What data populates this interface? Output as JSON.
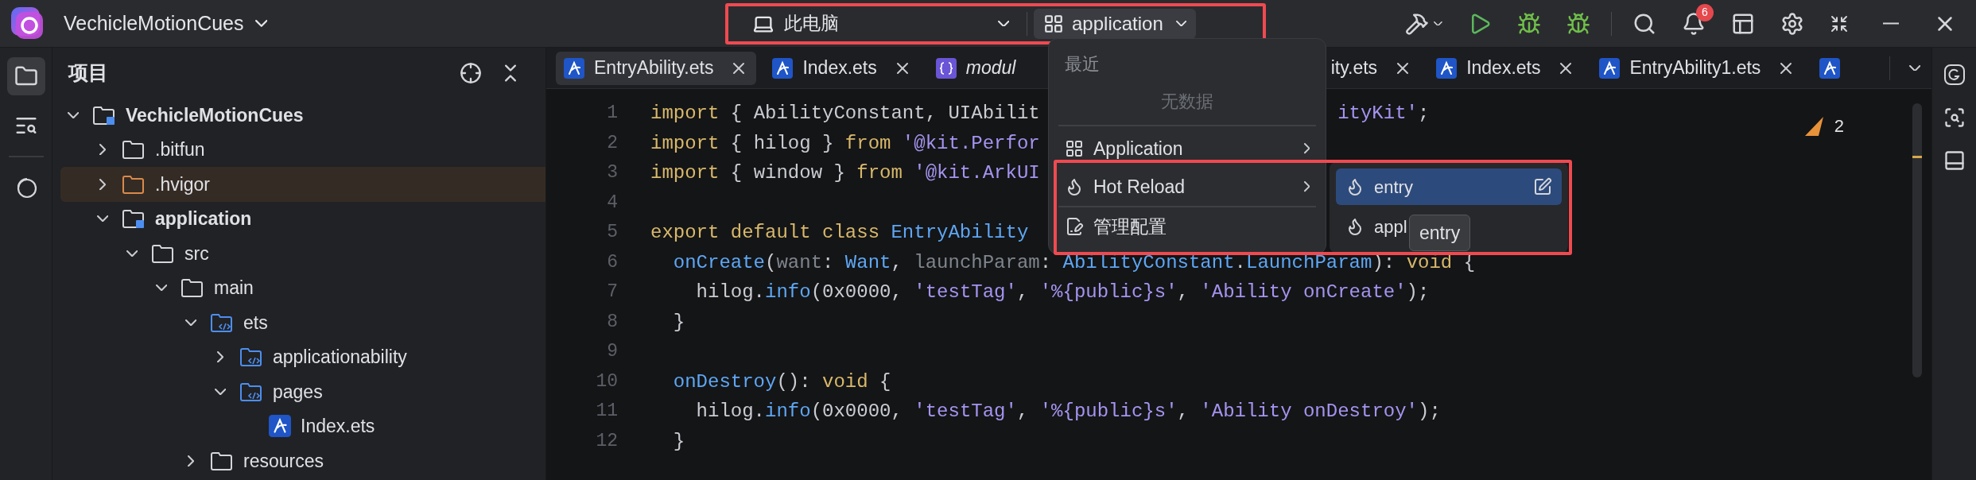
{
  "title_bar": {
    "project": "VechicleMotionCues",
    "device": "此电脑",
    "module": "application",
    "notification_count": "6"
  },
  "activity_bar": [
    {
      "kind": "project",
      "selected": true
    },
    {
      "kind": "find",
      "selected": false
    },
    {
      "kind": "rings",
      "selected": false
    }
  ],
  "project_panel": {
    "title": "项目",
    "tree": [
      {
        "label": "VechicleMotionCues",
        "kind": "module",
        "expanded": true,
        "selected": false,
        "children": [
          {
            "label": ".bitfun",
            "kind": "folder",
            "expanded": false,
            "selected": false
          },
          {
            "label": ".hvigor",
            "kind": "excluded",
            "expanded": false,
            "selected": true
          },
          {
            "label": "application",
            "kind": "module",
            "expanded": true,
            "selected": false,
            "children": [
              {
                "label": "src",
                "kind": "folder",
                "expanded": true,
                "selected": false,
                "children": [
                  {
                    "label": "main",
                    "kind": "folder",
                    "expanded": true,
                    "selected": false,
                    "children": [
                      {
                        "label": "ets",
                        "kind": "source",
                        "expanded": true,
                        "selected": false,
                        "children": [
                          {
                            "label": "applicationability",
                            "kind": "source",
                            "expanded": false,
                            "selected": false
                          },
                          {
                            "label": "pages",
                            "kind": "source",
                            "expanded": true,
                            "selected": false,
                            "children": [
                              {
                                "label": "Index.ets",
                                "kind": "file",
                                "selected": false
                              }
                            ]
                          }
                        ]
                      },
                      {
                        "label": "resources",
                        "kind": "folder",
                        "expanded": false,
                        "selected": false
                      }
                    ]
                  }
                ]
              }
            ]
          }
        ]
      }
    ]
  },
  "tabs": [
    {
      "label": "EntryAbility.ets",
      "kind": "ark",
      "selected": true
    },
    {
      "label": "Index.ets",
      "kind": "ark",
      "selected": false
    },
    {
      "label": "modul",
      "kind": "json",
      "selected": false
    },
    {
      "label": "ity.ets",
      "kind": "cut",
      "selected": false
    },
    {
      "label": "Index.ets",
      "kind": "ark",
      "selected": false
    },
    {
      "label": "EntryAbility1.ets",
      "kind": "ark",
      "selected": false
    },
    {
      "kind": "ark",
      "selected": false
    }
  ],
  "code": [
    {
      "number": "1",
      "tokens": [
        {
          "text": "import",
          "kind": "keyword"
        },
        {
          "text": " { AbilityConstant, UIAbilit",
          "kind": "plain"
        }
      ],
      "after": [
        {
          "text": "ityKit'",
          "kind": "string"
        },
        {
          "text": ";",
          "kind": "plain"
        }
      ]
    },
    {
      "number": "2",
      "tokens": [
        {
          "text": "import",
          "kind": "keyword"
        },
        {
          "text": " { hilog } ",
          "kind": "plain"
        },
        {
          "text": "from",
          "kind": "keyword"
        },
        {
          "text": " '@kit.Perfor",
          "kind": "string"
        }
      ]
    },
    {
      "number": "3",
      "tokens": [
        {
          "text": "import",
          "kind": "keyword"
        },
        {
          "text": " { window } ",
          "kind": "plain"
        },
        {
          "text": "from",
          "kind": "keyword"
        },
        {
          "text": " '@kit.ArkUI",
          "kind": "string"
        }
      ]
    },
    {
      "number": "4"
    },
    {
      "number": "5",
      "tokens": [
        {
          "text": "export default class ",
          "kind": "keyword"
        },
        {
          "text": "EntryAbility",
          "kind": "function"
        }
      ]
    },
    {
      "number": "6",
      "tokens": [
        {
          "text": "  onCreate",
          "kind": "function"
        },
        {
          "text": "(",
          "kind": "plain"
        },
        {
          "text": "want",
          "kind": "param"
        },
        {
          "text": ": ",
          "kind": "plain"
        },
        {
          "text": "Want",
          "kind": "function"
        },
        {
          "text": ", ",
          "kind": "plain"
        },
        {
          "text": "launchParam",
          "kind": "param"
        },
        {
          "text": ": ",
          "kind": "plain"
        },
        {
          "text": "AbilityConstant",
          "kind": "function"
        },
        {
          "text": ".",
          "kind": "plain"
        },
        {
          "text": "LaunchParam",
          "kind": "function"
        },
        {
          "text": "): ",
          "kind": "plain"
        },
        {
          "text": "void",
          "kind": "keyword"
        },
        {
          "text": " {",
          "kind": "plain"
        }
      ]
    },
    {
      "number": "7",
      "tokens": [
        {
          "text": "    hilog.",
          "kind": "plain"
        },
        {
          "text": "info",
          "kind": "function"
        },
        {
          "text": "(0x0000, ",
          "kind": "plain"
        },
        {
          "text": "'testTag'",
          "kind": "string"
        },
        {
          "text": ", ",
          "kind": "plain"
        },
        {
          "text": "'%{public}s'",
          "kind": "string"
        },
        {
          "text": ", ",
          "kind": "plain"
        },
        {
          "text": "'Ability onCreate'",
          "kind": "string"
        },
        {
          "text": ");",
          "kind": "plain"
        }
      ]
    },
    {
      "number": "8",
      "tokens": [
        {
          "text": "  }",
          "kind": "plain"
        }
      ]
    },
    {
      "number": "9"
    },
    {
      "number": "10",
      "tokens": [
        {
          "text": "  onDestroy",
          "kind": "function"
        },
        {
          "text": "(): ",
          "kind": "plain"
        },
        {
          "text": "void",
          "kind": "keyword"
        },
        {
          "text": " {",
          "kind": "plain"
        }
      ]
    },
    {
      "number": "11",
      "tokens": [
        {
          "text": "    hilog.",
          "kind": "plain"
        },
        {
          "text": "info",
          "kind": "function"
        },
        {
          "text": "(0x0000, ",
          "kind": "plain"
        },
        {
          "text": "'testTag'",
          "kind": "string"
        },
        {
          "text": ", ",
          "kind": "plain"
        },
        {
          "text": "'%{public}s'",
          "kind": "string"
        },
        {
          "text": ", ",
          "kind": "plain"
        },
        {
          "text": "'Ability onDestroy'",
          "kind": "string"
        },
        {
          "text": ");",
          "kind": "plain"
        }
      ]
    },
    {
      "number": "12",
      "tokens": [
        {
          "text": "  }",
          "kind": "plain"
        }
      ]
    }
  ],
  "inspection": {
    "count": "2"
  },
  "run_menu": {
    "header": "最近",
    "empty_text": "无数据",
    "items": [
      {
        "label": "Application",
        "kind": "app",
        "submenu": true
      },
      {
        "label": "Hot Reload",
        "kind": "reload",
        "submenu": true
      },
      {
        "label": "管理配置",
        "kind": "config",
        "submenu": false
      }
    ]
  },
  "submenu": [
    {
      "label": "entry",
      "selected": true
    },
    {
      "label": "appl",
      "selected": false
    }
  ],
  "tooltip": "entry"
}
